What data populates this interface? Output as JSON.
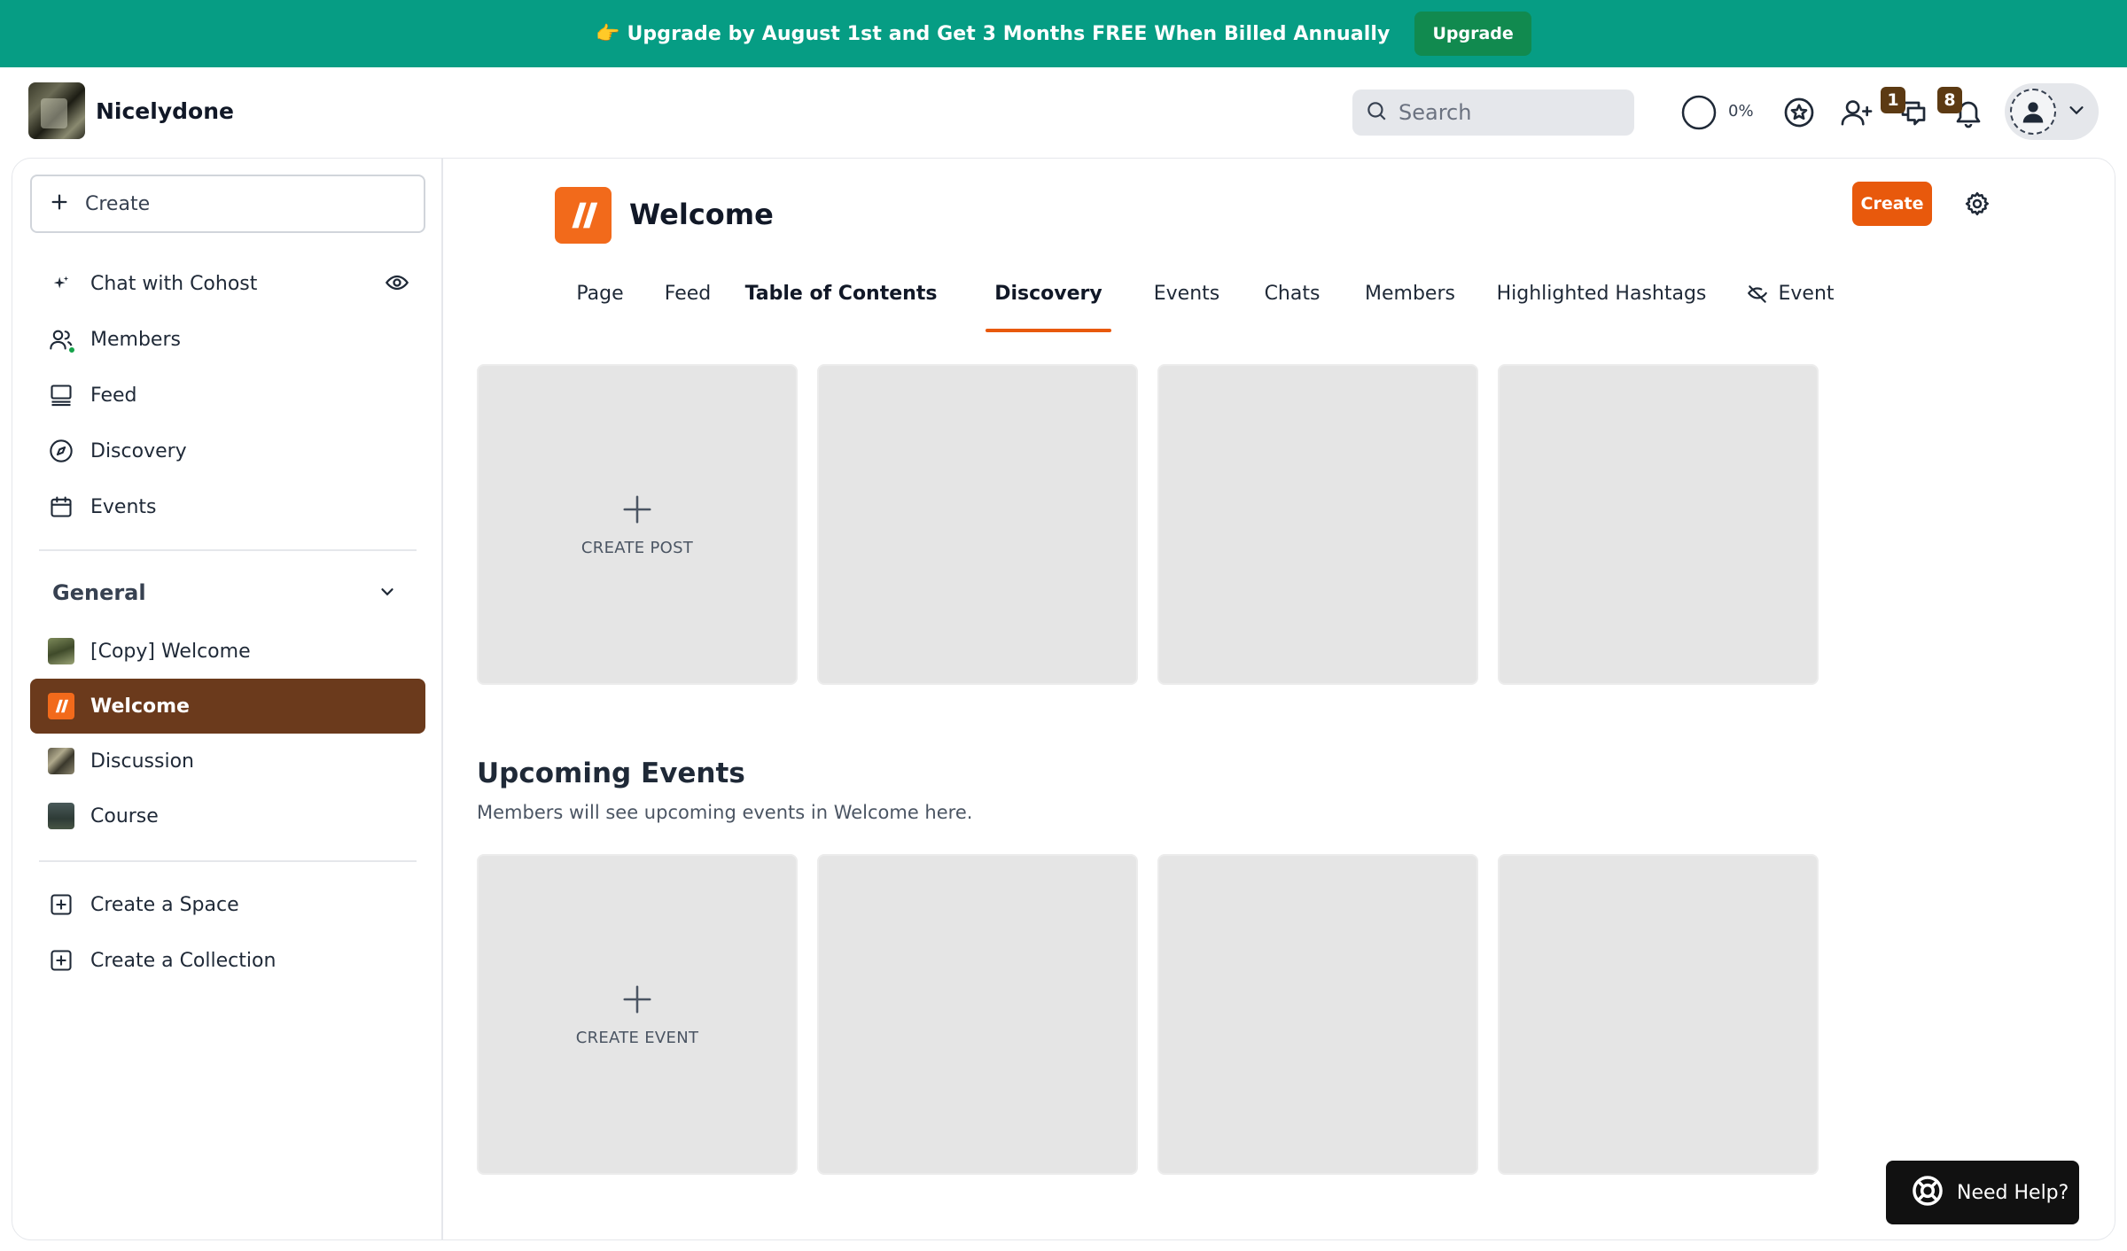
{
  "banner": {
    "text": "👉 Upgrade by August 1st and Get 3 Months FREE When Billed Annually",
    "button_label": "Upgrade"
  },
  "header": {
    "brand_name": "Nicelydone",
    "search_placeholder": "Search",
    "progress_label": "0%",
    "messages_badge": "1",
    "notifications_badge": "8"
  },
  "sidebar": {
    "create_label": "Create",
    "nav": [
      {
        "label": "Chat with Cohost",
        "icon": "sparkle-icon"
      },
      {
        "label": "Members",
        "icon": "members-icon"
      },
      {
        "label": "Feed",
        "icon": "feed-icon"
      },
      {
        "label": "Discovery",
        "icon": "compass-icon"
      },
      {
        "label": "Events",
        "icon": "calendar-icon"
      }
    ],
    "section_title": "General",
    "spaces": [
      {
        "label": "[Copy] Welcome",
        "active": false
      },
      {
        "label": "Welcome",
        "active": true
      },
      {
        "label": "Discussion",
        "active": false
      },
      {
        "label": "Course",
        "active": false
      }
    ],
    "footer_links": [
      {
        "label": "Create a Space",
        "icon": "plus-square-icon"
      },
      {
        "label": "Create a Collection",
        "icon": "plus-square-icon"
      }
    ]
  },
  "main": {
    "title": "Welcome",
    "create_button": "Create",
    "tabs": [
      {
        "label": "Page",
        "style": "normal"
      },
      {
        "label": "Feed",
        "style": "normal"
      },
      {
        "label": "Table of Contents",
        "style": "bold"
      },
      {
        "label": "Discovery",
        "style": "active"
      },
      {
        "label": "Events",
        "style": "normal"
      },
      {
        "label": "Chats",
        "style": "normal"
      },
      {
        "label": "Members",
        "style": "normal"
      },
      {
        "label": "Highlighted Hashtags",
        "style": "normal"
      },
      {
        "label": "Event",
        "style": "hidden"
      }
    ],
    "posts_card_caption": "CREATE POST",
    "events_heading": "Upcoming Events",
    "events_subtitle": "Members will see upcoming events in Welcome here.",
    "events_card_caption": "CREATE EVENT"
  },
  "help_button": "Need Help?",
  "colors": {
    "banner": "#069d84",
    "upgrade_button": "#118a4f",
    "accent": "#e8590c",
    "active_space": "#6b3a1c",
    "badge": "#5c3a13"
  }
}
